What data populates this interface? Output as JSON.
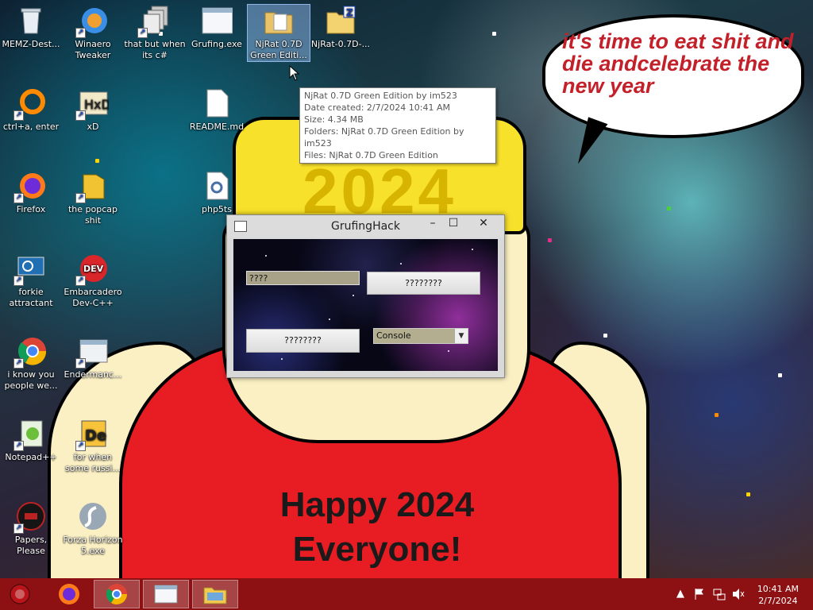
{
  "desktop": {
    "icons": [
      {
        "label": "MEMZ-Dest...",
        "icon": "recycle-bin-icon"
      },
      {
        "label": "Winaero Tweaker",
        "icon": "winaero-icon"
      },
      {
        "label": "that but when its c#",
        "icon": "file-stack-icon"
      },
      {
        "label": "Grufing.exe",
        "icon": "exe-icon"
      },
      {
        "label": "NjRat 0.7D Green Editi...",
        "icon": "folder-icon"
      },
      {
        "label": "NjRat-0.7D-...",
        "icon": "zip-folder-icon"
      },
      {
        "label": "ctrl+a, enter",
        "icon": "orange-ring-icon"
      },
      {
        "label": "xD",
        "icon": "hxd-icon"
      },
      {
        "label": "README.md",
        "icon": "document-icon"
      },
      {
        "label": "Firefox",
        "icon": "firefox-icon"
      },
      {
        "label": "the popcap shit",
        "icon": "popcap-icon"
      },
      {
        "label": "php5ts",
        "icon": "gear-file-icon"
      },
      {
        "label": "forkie attractant",
        "icon": "monitor-gear-icon"
      },
      {
        "label": "Embarcadero Dev-C++",
        "icon": "devcpp-icon"
      },
      {
        "label": "i know you people we...",
        "icon": "chrome-icon"
      },
      {
        "label": "Endermanc...",
        "icon": "window-icon"
      },
      {
        "label": "Notepad++",
        "icon": "notepadpp-icon"
      },
      {
        "label": "for when some russi...",
        "icon": "de-icon"
      },
      {
        "label": "Papers, Please",
        "icon": "papers-icon"
      },
      {
        "label": "Forza Horizon 5.exe",
        "icon": "flash-icon"
      }
    ]
  },
  "wallpaper": {
    "bubble_text": "it's time to eat shit and die andcelebrate the new year",
    "hat_text": "2024",
    "shirt_text": "Happy 2024 Everyone!"
  },
  "tooltip": {
    "lines": [
      "NjRat 0.7D Green Edition by im523",
      "Date created: 2/7/2024 10:41 AM",
      "Size: 4.34 MB",
      "Folders: NjRat 0.7D Green Edition by im523",
      "Files: NjRat 0.7D Green Edition"
    ]
  },
  "window": {
    "title": "GrufingHack",
    "minimize": "–",
    "maximize": "☐",
    "close": "✕",
    "text_field": "????",
    "button_top": "????????",
    "button_bottom": "????????",
    "combo_value": "Console",
    "combo_arrow": "▼"
  },
  "taskbar": {
    "apps": [
      {
        "name": "start",
        "icon": "start-orb-icon"
      },
      {
        "name": "firefox",
        "icon": "firefox-icon"
      },
      {
        "name": "chrome",
        "icon": "chrome-icon"
      },
      {
        "name": "window",
        "icon": "app-window-icon"
      },
      {
        "name": "explorer",
        "icon": "explorer-icon"
      }
    ],
    "time": "10:41 AM",
    "date": "2/7/2024",
    "tray_up": "▲"
  },
  "colors": {
    "taskbar": "#8d1012",
    "bubble_text": "#c3202a",
    "shirt": "#e81d24",
    "hat": "#f7e12a"
  }
}
